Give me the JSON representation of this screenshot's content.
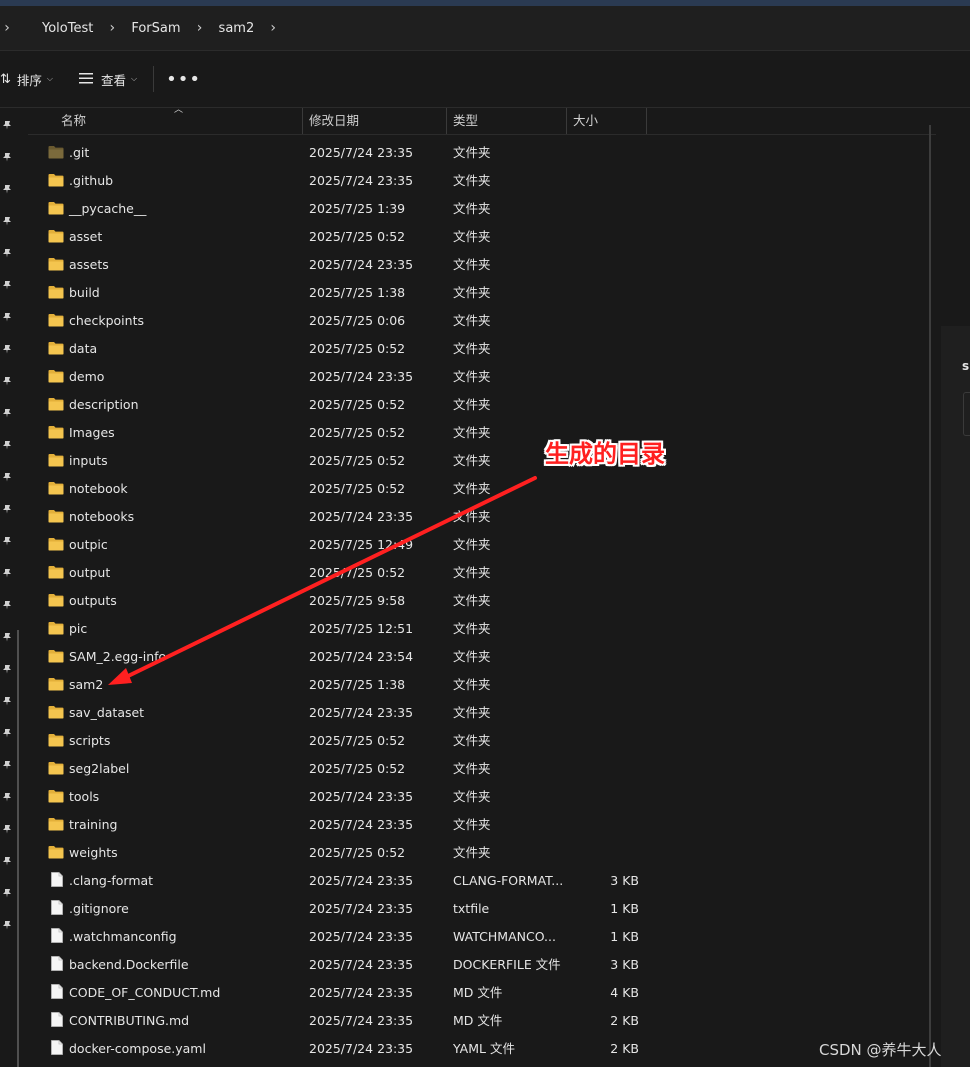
{
  "breadcrumb": [
    "YoloTest",
    "ForSam",
    "sam2"
  ],
  "toolbar": {
    "sort_label": "排序",
    "view_label": "查看",
    "more_label": "•••"
  },
  "columns": {
    "name": "名称",
    "date": "修改日期",
    "type": "类型",
    "size": "大小"
  },
  "files": [
    {
      "name": ".git",
      "date": "2025/7/24 23:35",
      "type": "文件夹",
      "size": "",
      "kind": "folder-dim"
    },
    {
      "name": ".github",
      "date": "2025/7/24 23:35",
      "type": "文件夹",
      "size": "",
      "kind": "folder"
    },
    {
      "name": "__pycache__",
      "date": "2025/7/25 1:39",
      "type": "文件夹",
      "size": "",
      "kind": "folder"
    },
    {
      "name": "asset",
      "date": "2025/7/25 0:52",
      "type": "文件夹",
      "size": "",
      "kind": "folder"
    },
    {
      "name": "assets",
      "date": "2025/7/24 23:35",
      "type": "文件夹",
      "size": "",
      "kind": "folder"
    },
    {
      "name": "build",
      "date": "2025/7/25 1:38",
      "type": "文件夹",
      "size": "",
      "kind": "folder"
    },
    {
      "name": "checkpoints",
      "date": "2025/7/25 0:06",
      "type": "文件夹",
      "size": "",
      "kind": "folder"
    },
    {
      "name": "data",
      "date": "2025/7/25 0:52",
      "type": "文件夹",
      "size": "",
      "kind": "folder"
    },
    {
      "name": "demo",
      "date": "2025/7/24 23:35",
      "type": "文件夹",
      "size": "",
      "kind": "folder"
    },
    {
      "name": "description",
      "date": "2025/7/25 0:52",
      "type": "文件夹",
      "size": "",
      "kind": "folder"
    },
    {
      "name": "Images",
      "date": "2025/7/25 0:52",
      "type": "文件夹",
      "size": "",
      "kind": "folder"
    },
    {
      "name": "inputs",
      "date": "2025/7/25 0:52",
      "type": "文件夹",
      "size": "",
      "kind": "folder"
    },
    {
      "name": "notebook",
      "date": "2025/7/25 0:52",
      "type": "文件夹",
      "size": "",
      "kind": "folder"
    },
    {
      "name": "notebooks",
      "date": "2025/7/24 23:35",
      "type": "文件夹",
      "size": "",
      "kind": "folder"
    },
    {
      "name": "outpic",
      "date": "2025/7/25 12:49",
      "type": "文件夹",
      "size": "",
      "kind": "folder"
    },
    {
      "name": "output",
      "date": "2025/7/25 0:52",
      "type": "文件夹",
      "size": "",
      "kind": "folder"
    },
    {
      "name": "outputs",
      "date": "2025/7/25 9:58",
      "type": "文件夹",
      "size": "",
      "kind": "folder"
    },
    {
      "name": "pic",
      "date": "2025/7/25 12:51",
      "type": "文件夹",
      "size": "",
      "kind": "folder"
    },
    {
      "name": "SAM_2.egg-info",
      "date": "2025/7/24 23:54",
      "type": "文件夹",
      "size": "",
      "kind": "folder"
    },
    {
      "name": "sam2",
      "date": "2025/7/25 1:38",
      "type": "文件夹",
      "size": "",
      "kind": "folder"
    },
    {
      "name": "sav_dataset",
      "date": "2025/7/24 23:35",
      "type": "文件夹",
      "size": "",
      "kind": "folder"
    },
    {
      "name": "scripts",
      "date": "2025/7/25 0:52",
      "type": "文件夹",
      "size": "",
      "kind": "folder"
    },
    {
      "name": "seg2label",
      "date": "2025/7/25 0:52",
      "type": "文件夹",
      "size": "",
      "kind": "folder"
    },
    {
      "name": "tools",
      "date": "2025/7/24 23:35",
      "type": "文件夹",
      "size": "",
      "kind": "folder"
    },
    {
      "name": "training",
      "date": "2025/7/24 23:35",
      "type": "文件夹",
      "size": "",
      "kind": "folder"
    },
    {
      "name": "weights",
      "date": "2025/7/25 0:52",
      "type": "文件夹",
      "size": "",
      "kind": "folder"
    },
    {
      "name": ".clang-format",
      "date": "2025/7/24 23:35",
      "type": "CLANG-FORMAT...",
      "size": "3 KB",
      "kind": "file"
    },
    {
      "name": ".gitignore",
      "date": "2025/7/24 23:35",
      "type": "txtfile",
      "size": "1 KB",
      "kind": "file"
    },
    {
      "name": ".watchmanconfig",
      "date": "2025/7/24 23:35",
      "type": "WATCHMANCO...",
      "size": "1 KB",
      "kind": "file"
    },
    {
      "name": "backend.Dockerfile",
      "date": "2025/7/24 23:35",
      "type": "DOCKERFILE 文件",
      "size": "3 KB",
      "kind": "file"
    },
    {
      "name": "CODE_OF_CONDUCT.md",
      "date": "2025/7/24 23:35",
      "type": "MD 文件",
      "size": "4 KB",
      "kind": "file"
    },
    {
      "name": "CONTRIBUTING.md",
      "date": "2025/7/24 23:35",
      "type": "MD 文件",
      "size": "2 KB",
      "kind": "file"
    },
    {
      "name": "docker-compose.yaml",
      "date": "2025/7/24 23:35",
      "type": "YAML 文件",
      "size": "2 KB",
      "kind": "file"
    }
  ],
  "right_panel": {
    "letter": "s"
  },
  "annotation": {
    "text": "生成的目录",
    "color": "#ff2020"
  },
  "watermark": "CSDN @养牛大人",
  "colors": {
    "background": "#191919",
    "folder": "#f4c54f",
    "text": "#e6e6e6"
  }
}
